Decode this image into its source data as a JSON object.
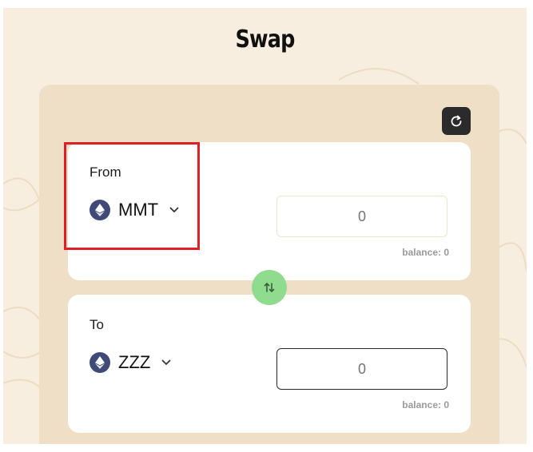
{
  "title": "Swap",
  "from": {
    "label": "From",
    "token": "MMT",
    "amount_placeholder": "0",
    "balance": "balance: 0"
  },
  "to": {
    "label": "To",
    "token": "ZZZ",
    "amount_placeholder": "0",
    "balance": "balance: 0"
  },
  "icons": {
    "refresh": "refresh-icon",
    "switch": "swap-arrows-icon",
    "token": "ethereum-icon",
    "dropdown": "chevron-down-icon"
  },
  "colors": {
    "background": "#f8eee0",
    "panel": "#efdfc6",
    "switch_button": "#8fdc8f",
    "highlight": "#e01e26"
  }
}
